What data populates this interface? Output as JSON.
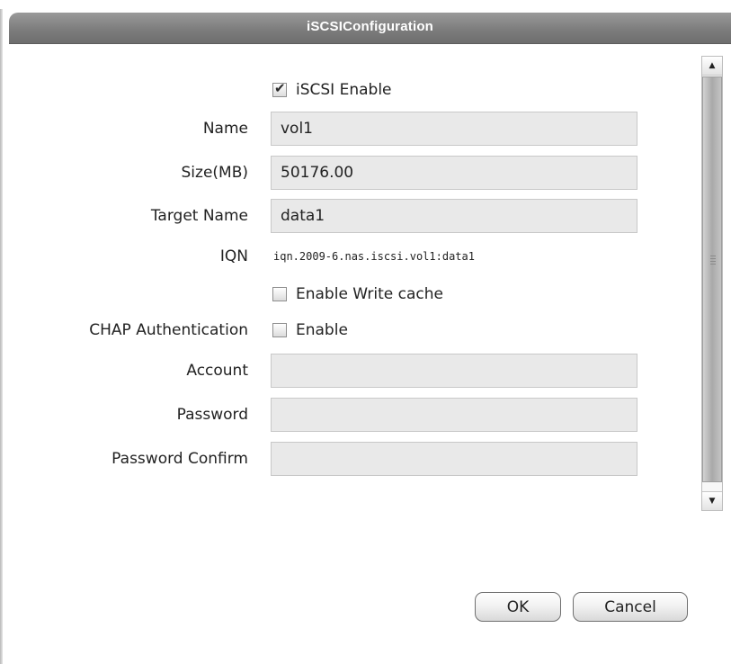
{
  "window": {
    "title": "iSCSIConfiguration"
  },
  "form": {
    "iscsi_enable": {
      "label": "iSCSI Enable",
      "checked": true
    },
    "name": {
      "label": "Name",
      "value": "vol1"
    },
    "size": {
      "label": "Size(MB)",
      "value": "50176.00"
    },
    "target_name": {
      "label": "Target Name",
      "value": "data1"
    },
    "iqn": {
      "label": "IQN",
      "value": "iqn.2009-6.nas.iscsi.vol1:data1"
    },
    "write_cache": {
      "label": "Enable Write cache",
      "checked": false
    },
    "chap": {
      "label": "CHAP Authentication",
      "enable_label": "Enable",
      "checked": false
    },
    "account": {
      "label": "Account",
      "value": ""
    },
    "password": {
      "label": "Password",
      "value": ""
    },
    "password_confirm": {
      "label": "Password Confirm",
      "value": ""
    }
  },
  "buttons": {
    "ok": "OK",
    "cancel": "Cancel"
  },
  "icons": {
    "scroll_up": "arrow-up-icon",
    "scroll_down": "arrow-down-icon",
    "checkmark": "checkmark-icon"
  }
}
